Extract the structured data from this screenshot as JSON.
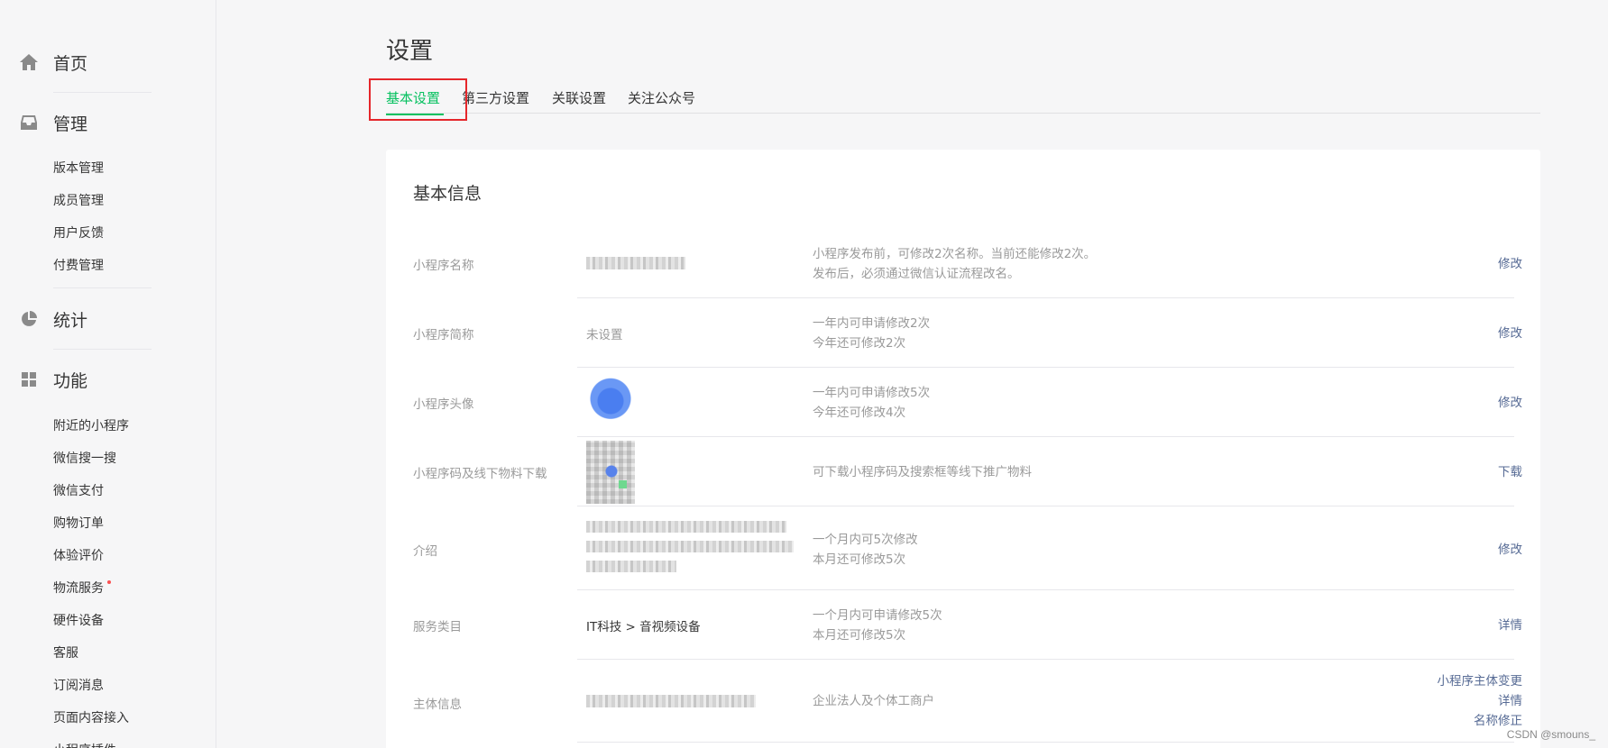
{
  "sidebar": {
    "home": {
      "label": "首页",
      "icon": "home-icon"
    },
    "manage": {
      "label": "管理",
      "icon": "inbox-icon",
      "items": [
        "版本管理",
        "成员管理",
        "用户反馈",
        "付费管理"
      ]
    },
    "stats": {
      "label": "统计",
      "icon": "pie-chart-icon"
    },
    "features": {
      "label": "功能",
      "icon": "grid-icon",
      "items": [
        "附近的小程序",
        "微信搜一搜",
        "微信支付",
        "购物订单",
        "体验评价",
        "物流服务",
        "硬件设备",
        "客服",
        "订阅消息",
        "页面内容接入",
        "小程序插件"
      ]
    }
  },
  "page": {
    "title": "设置"
  },
  "tabs": [
    "基本设置",
    "第三方设置",
    "关联设置",
    "关注公众号"
  ],
  "card": {
    "title": "基本信息",
    "rows": [
      {
        "label": "小程序名称",
        "value": "",
        "desc": [
          "小程序发布前，可修改2次名称。当前还能修改2次。",
          "发布后，必须通过微信认证流程改名。"
        ],
        "actions": [
          "修改"
        ]
      },
      {
        "label": "小程序简称",
        "value": "未设置",
        "desc": [
          "一年内可申请修改2次",
          "今年还可修改2次"
        ],
        "actions": [
          "修改"
        ]
      },
      {
        "label": "小程序头像",
        "value": "",
        "desc": [
          "一年内可申请修改5次",
          "今年还可修改4次"
        ],
        "actions": [
          "修改"
        ]
      },
      {
        "label": "小程序码及线下物料下载",
        "value": "",
        "desc": [
          "可下载小程序码及搜索框等线下推广物料"
        ],
        "actions": [
          "下载"
        ]
      },
      {
        "label": "介绍",
        "value": "",
        "desc": [
          "一个月内可5次修改",
          "本月还可修改5次"
        ],
        "actions": [
          "修改"
        ]
      },
      {
        "label": "服务类目",
        "value": "IT科技 > 音视频设备",
        "desc": [
          "一个月内可申请修改5次",
          "本月还可修改5次"
        ],
        "actions": [
          "详情"
        ]
      },
      {
        "label": "主体信息",
        "value": "",
        "desc": [
          "企业法人及个体工商户"
        ],
        "actions": [
          "小程序主体变更",
          "详情",
          "名称修正"
        ]
      }
    ]
  },
  "watermark": "CSDN @smouns_",
  "colors": {
    "accent": "#07c160",
    "link": "#576b95",
    "highlight": "#e5262b"
  }
}
